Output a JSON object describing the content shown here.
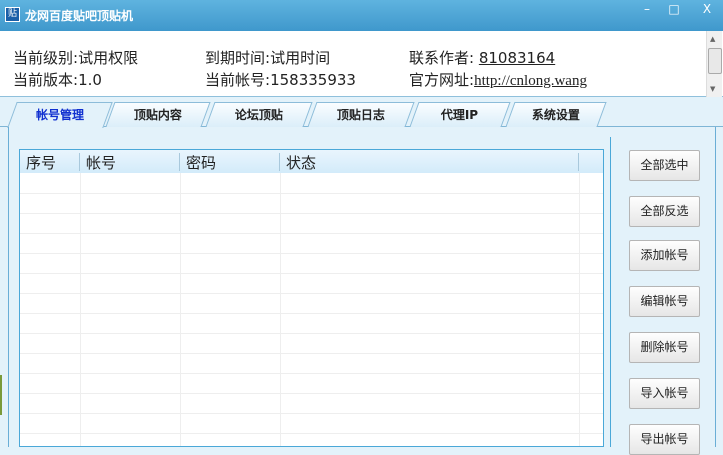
{
  "window": {
    "title": "龙网百度贴吧顶贴机",
    "logo": "贴",
    "minimize": "–",
    "maximize": "□",
    "close": "X"
  },
  "info": {
    "level_label": "当前级别:",
    "level_value": "试用权限",
    "expire_label": "到期时间:",
    "expire_value": "试用时间",
    "contact_label": "联系作者:",
    "contact_value": "81083164",
    "version_label": "当前版本:",
    "version_value": "1.0",
    "account_label": "当前帐号:",
    "account_value": "158335933",
    "site_label": "官方网址:",
    "site_value": "http://cnlong.wang"
  },
  "tabs": [
    "帐号管理",
    "顶贴内容",
    "论坛顶贴",
    "顶贴日志",
    "代理IP",
    "系统设置"
  ],
  "table": {
    "columns": [
      "序号",
      "帐号",
      "密码",
      "状态"
    ]
  },
  "buttons": [
    "全部选中",
    "全部反选",
    "添加帐号",
    "编辑帐号",
    "删除帐号",
    "导入帐号",
    "导出帐号"
  ]
}
